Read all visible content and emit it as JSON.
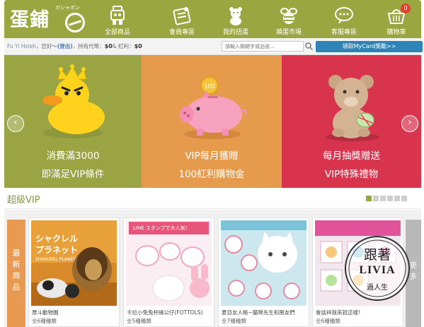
{
  "header": {
    "logo_text": "蛋鋪",
    "logo_kana": "ガシャポン",
    "nav": [
      {
        "label": "全部商品",
        "icon": "gashapon-robot-icon"
      },
      {
        "label": "會員專區",
        "icon": "member-card-icon"
      },
      {
        "label": "我的扭蛋",
        "icon": "teddy-bear-icon"
      },
      {
        "label": "蹺蛋市場",
        "icon": "bee-icon"
      },
      {
        "label": "客服專區",
        "icon": "chat-bubble-icon"
      },
      {
        "label": "購物車",
        "icon": "shopping-basket-icon"
      }
    ],
    "cart_count": "0",
    "colors": {
      "bar": "#9aa640",
      "badge": "#e5402e"
    }
  },
  "infobar": {
    "user_name": "Fu Yi Hsieh",
    "greeting": "，您好～",
    "logout_label": "(登出)",
    "points_label": "，持有代幣：",
    "points_value": "$0",
    "bonus_label": "& 紅利：",
    "bonus_value": "$0",
    "search_placeholder": "請輸入關鍵字或品號...",
    "mycard_label": "領取MyCard獎勵>>"
  },
  "banner": {
    "panels": [
      {
        "line1": "消費滿3000",
        "line2": "即滿足VIP條件",
        "color": "#9aa442",
        "icon": "crowned-duck-icon"
      },
      {
        "line1": "VIP每月獲贈",
        "line2": "100紅利購物金",
        "color": "#e59a4c",
        "icon": "piggy-bank-icon",
        "coin_text": "100"
      },
      {
        "line1": "每月抽獎贈送",
        "line2": "VIP特殊禮物",
        "color": "#d8344e",
        "icon": "teddy-gift-icon"
      }
    ],
    "prev_icon": "chevron-left-icon",
    "next_icon": "chevron-right-icon"
  },
  "vip": {
    "title": "超級VIP",
    "slides": 6,
    "active_slide": 1
  },
  "products": {
    "new_label": "最新商品",
    "more_label": "更多",
    "items": [
      {
        "name": "厚斗動物園",
        "count": "全6種種類",
        "banner_text": "シャクレル プラネット",
        "banner_sub": "SHAKUREL PLANET"
      },
      {
        "name": "卡拉小兔兔杯緣公仔(FOTTOLS)",
        "count": "全5種種類",
        "banner_text": "LINE スタンプで大人気!"
      },
      {
        "name": "夏目友人帳~貓咪先生和朋友們",
        "count": "全7種種類"
      },
      {
        "name": "會話祥我來就這樣!",
        "count": "全6種種類"
      }
    ]
  },
  "watermark": {
    "line1": "跟著",
    "line2": "LIVIA",
    "line3": "過人生"
  }
}
